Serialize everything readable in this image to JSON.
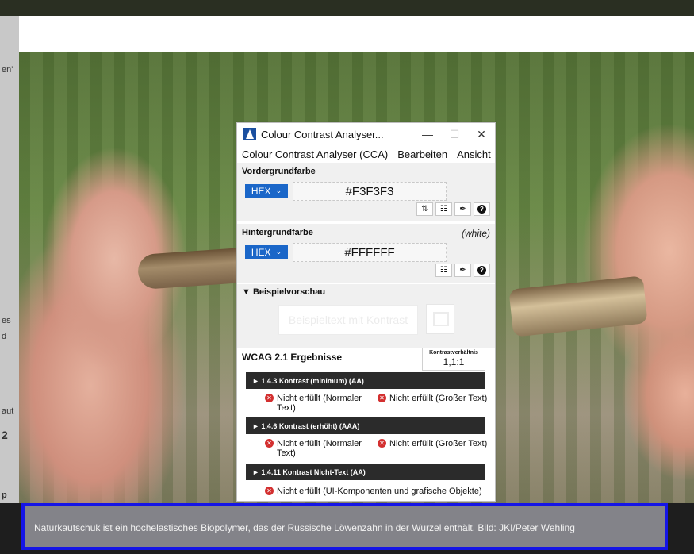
{
  "window": {
    "title": "Colour Contrast Analyser...",
    "minimize": "—",
    "maximize": "☐",
    "close": "✕"
  },
  "menu": [
    "Colour Contrast Analyser (CCA)",
    "Bearbeiten",
    "Ansicht"
  ],
  "foreground": {
    "label": "Vordergrundfarbe",
    "format": "HEX",
    "value": "#F3F3F3",
    "color": "#F3F3F3"
  },
  "background": {
    "label": "Hintergrundfarbe",
    "name": "(white)",
    "format": "HEX",
    "value": "#FFFFFF",
    "color": "#FFFFFF"
  },
  "preview": {
    "heading": "▼ Beispielvorschau",
    "sample_text": "Beispieltext mit Kontrast"
  },
  "wcag": {
    "title": "WCAG 2.1 Ergebnisse",
    "ratio_label": "Kontrastverhältnis",
    "ratio_value": "1,1:1",
    "criteria": [
      {
        "title": "► 1.4.3 Kontrast (minimum) (AA)",
        "results": [
          "Nicht erfüllt (Normaler Text)",
          "Nicht erfüllt (Großer Text)"
        ]
      },
      {
        "title": "► 1.4.6 Kontrast (erhöht) (AAA)",
        "results": [
          "Nicht erfüllt (Normaler Text)",
          "Nicht erfüllt (Großer Text)"
        ]
      },
      {
        "title": "► 1.4.11 Kontrast Nicht-Text (AA)",
        "results": [
          "Nicht erfüllt (UI-Komponenten und grafische Objekte)"
        ]
      }
    ]
  },
  "caption": "Naturkautschuk ist ein hochelastisches Biopolymer, das der Russische Löwenzahn in der Wurzel enthält. Bild: JKI/Peter Wehling",
  "left_fragments": [
    "en'",
    "es",
    "d",
    "aut",
    "2",
    "p"
  ],
  "colors": {
    "accent": "#1A66C8",
    "fail": "#D32F2F",
    "highlight": "#1515E6",
    "bar": "#2B2B2B"
  }
}
